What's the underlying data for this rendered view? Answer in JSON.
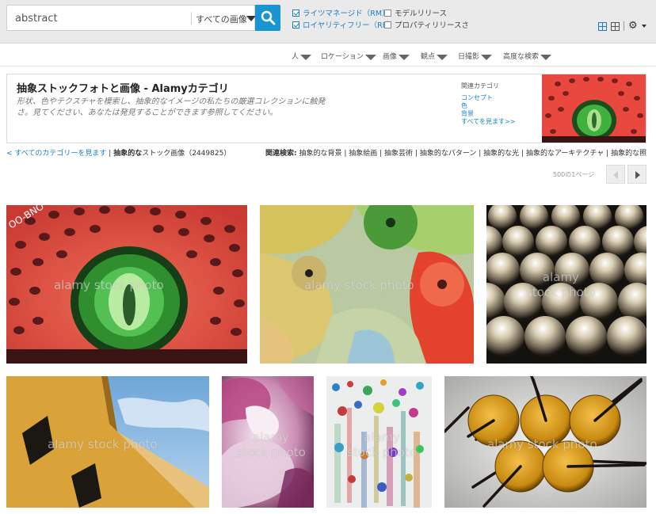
{
  "search": {
    "query": "abstract",
    "scope": "すべての画像"
  },
  "filters": [
    {
      "label": "ライツマネージド（RM）",
      "checked": true
    },
    {
      "label": "ロイヤリティフリー（RF）",
      "checked": true
    },
    {
      "label": "モデルリリース",
      "checked": false
    },
    {
      "label": "プロパティリリースさ",
      "checked": false
    }
  ],
  "subnav": [
    "人",
    "ロケーション",
    "画像",
    "観点",
    "日撮影",
    "高度な検索"
  ],
  "banner": {
    "title": "抽象ストックフォトと画像 - Alamyカテゴリ",
    "description": "形状、色やテクスチャを模索し、抽象的なイメージの私たちの厳選コレクションに触発さ。見てください、あなたは発見することができます参照してください。",
    "related_title": "関連カテゴリ",
    "related_links": [
      "コンセプト",
      "色",
      "背景",
      "すべてを見ます>>"
    ]
  },
  "breadcrumb": {
    "back_link": "< すべてのカテゴリーを見ます",
    "current_bold": "抽象的な",
    "current_rest": "ストック画像",
    "count": "（2449825）"
  },
  "related_search": {
    "label": "関連検索:",
    "items": [
      "抽象的な背景",
      "抽象絵画",
      "抽象芸術",
      "抽象的なパターン",
      "抽象的な光",
      "抽象的なアーキテクチャ",
      "抽象的な照"
    ]
  },
  "pager": {
    "text": "500の1ページ"
  },
  "watermark": "alamy stock photo",
  "watermark_split": [
    "alamy",
    "stock photo"
  ],
  "colors": {
    "accent": "#1995d2",
    "link": "#1a7ec2"
  }
}
